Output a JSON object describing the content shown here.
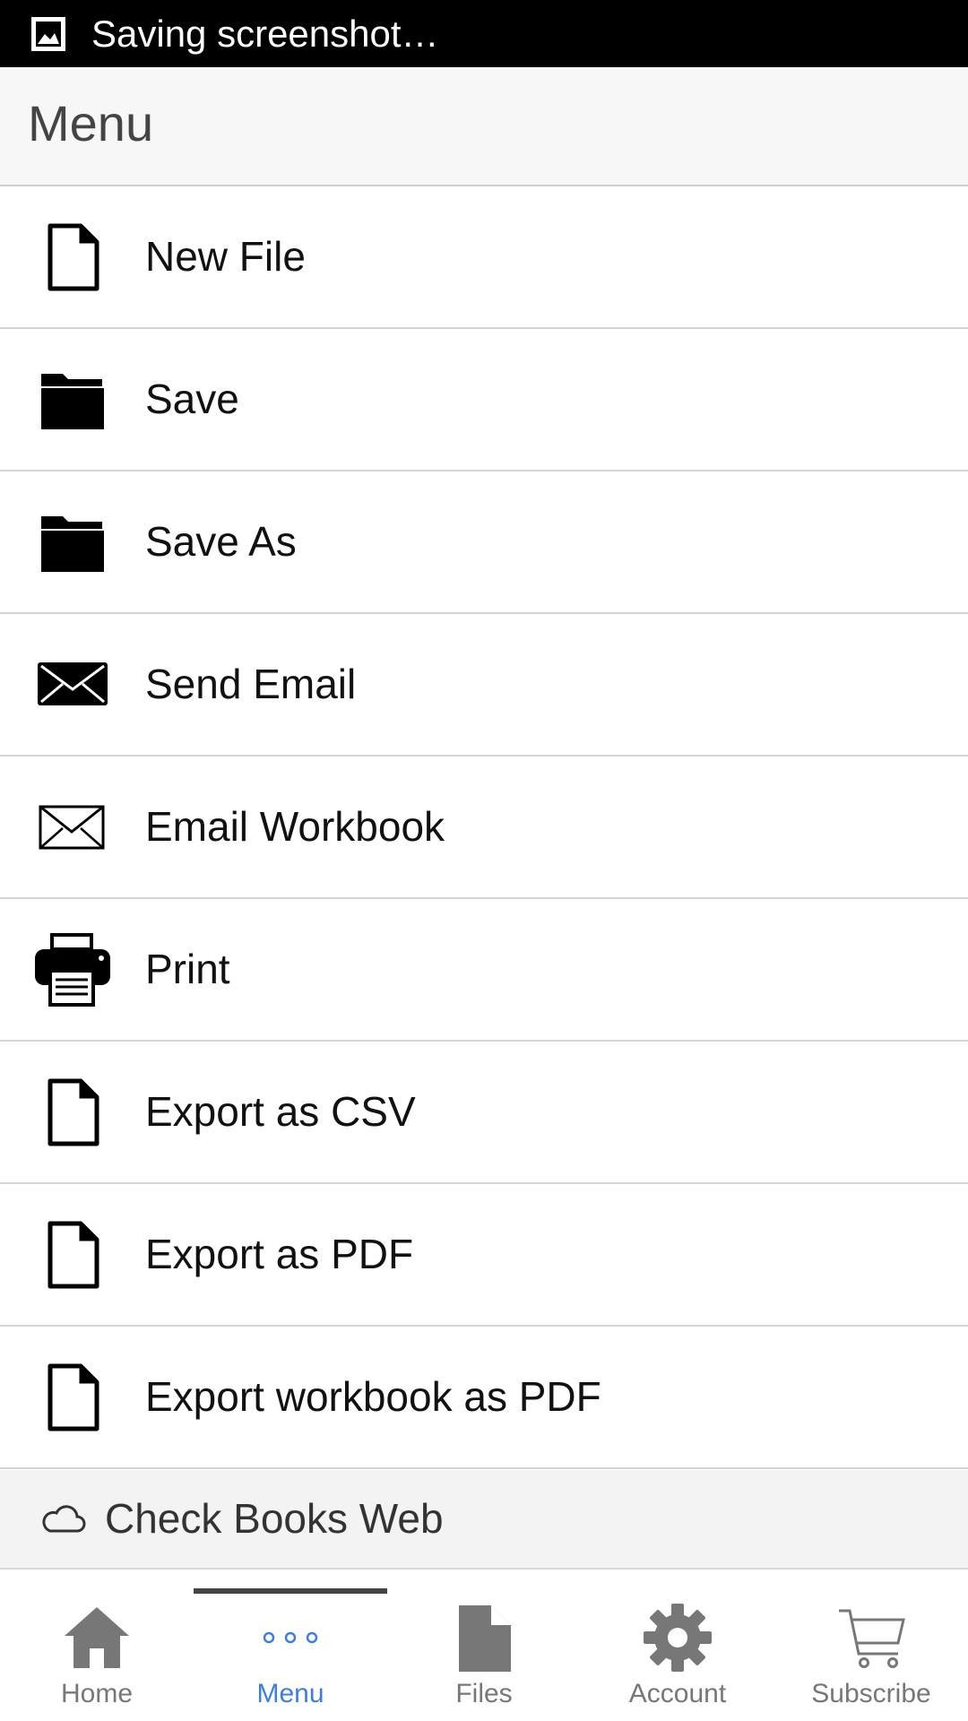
{
  "status_bar": {
    "text": "Saving screenshot…",
    "icon": "image-icon"
  },
  "header": {
    "title": "Menu"
  },
  "menu": {
    "items": [
      {
        "label": "New File",
        "icon": "file-icon"
      },
      {
        "label": "Save",
        "icon": "folder-icon"
      },
      {
        "label": "Save As",
        "icon": "folder-icon"
      },
      {
        "label": "Send Email",
        "icon": "envelope-filled-icon"
      },
      {
        "label": "Email Workbook",
        "icon": "envelope-outline-icon"
      },
      {
        "label": "Print",
        "icon": "printer-icon"
      },
      {
        "label": "Export as CSV",
        "icon": "file-icon"
      },
      {
        "label": "Export as PDF",
        "icon": "file-icon"
      },
      {
        "label": "Export workbook as PDF",
        "icon": "file-icon"
      }
    ]
  },
  "cloud_link": {
    "label": "Check Books Web",
    "icon": "cloud-icon"
  },
  "tabs": [
    {
      "label": "Home",
      "icon": "home-icon"
    },
    {
      "label": "Menu",
      "icon": "more-dots-icon",
      "active": true
    },
    {
      "label": "Files",
      "icon": "file-icon"
    },
    {
      "label": "Account",
      "icon": "gear-icon"
    },
    {
      "label": "Subscribe",
      "icon": "cart-icon"
    }
  ],
  "colors": {
    "active_tab": "#3d7fd9",
    "inactive_tab": "#777777",
    "status_bar": "#000000"
  }
}
